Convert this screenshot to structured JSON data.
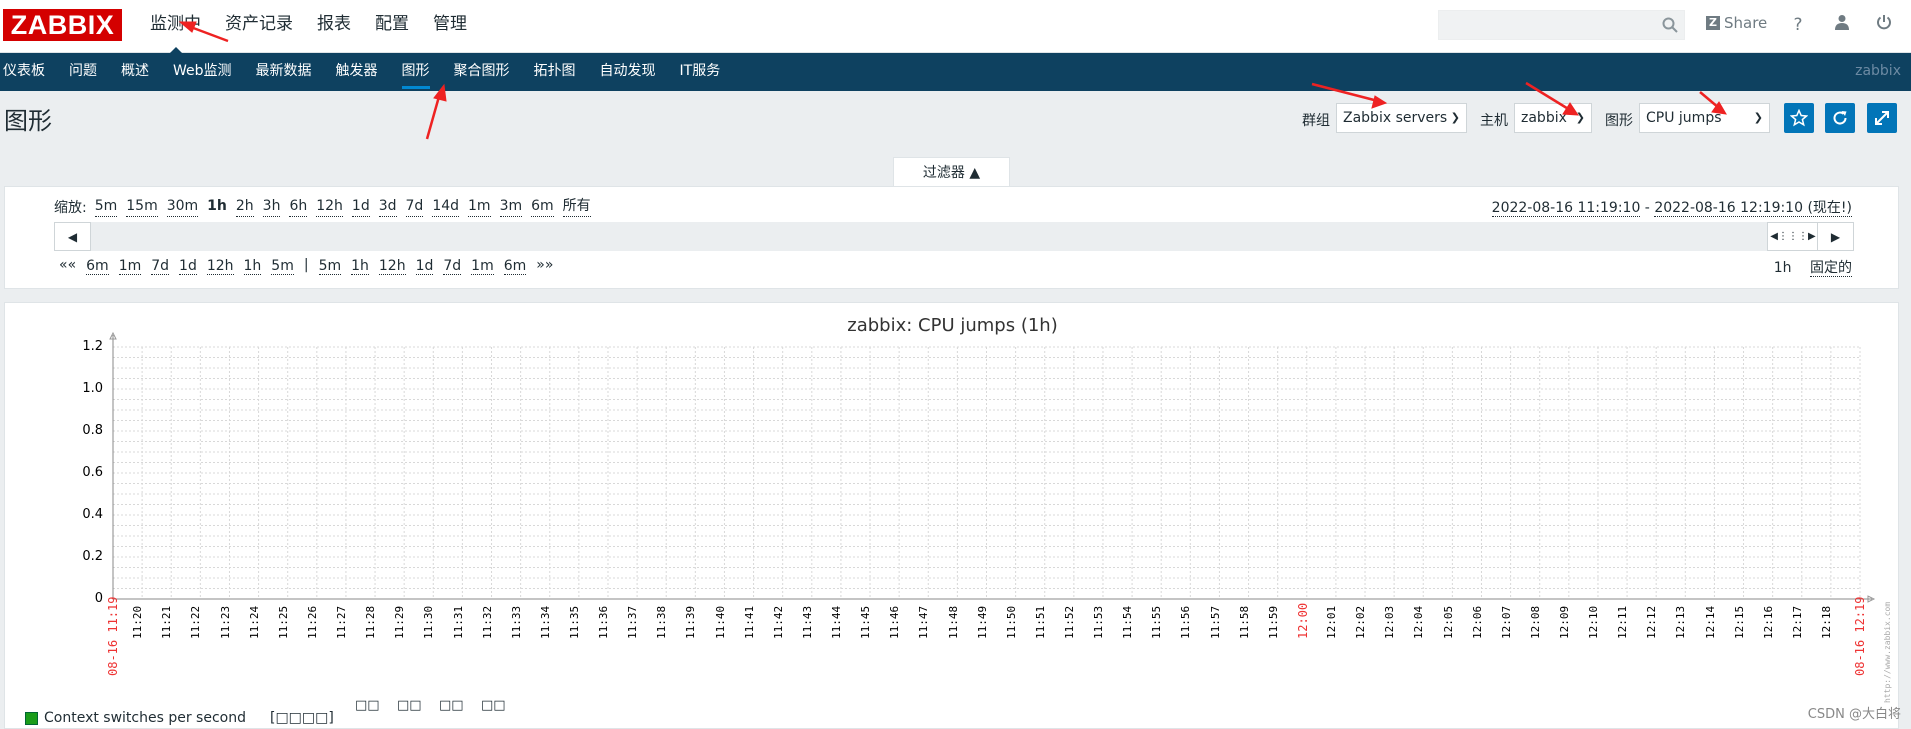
{
  "header": {
    "logo": "ZABBIX",
    "main_nav": [
      "监测中",
      "资产记录",
      "报表",
      "配置",
      "管理"
    ],
    "main_nav_active": 0,
    "search": {
      "value": "",
      "placeholder": ""
    },
    "share_label": "Share",
    "help_label": "?",
    "icons": [
      "search-icon",
      "share-icon",
      "help-icon",
      "user-icon",
      "power-icon"
    ]
  },
  "subnav": {
    "items": [
      "仪表板",
      "问题",
      "概述",
      "Web监测",
      "最新数据",
      "触发器",
      "图形",
      "聚合图形",
      "拓扑图",
      "自动发现",
      "IT服务"
    ],
    "active": 6,
    "user": "zabbix",
    "accent": "#0e4160"
  },
  "page": {
    "title": "图形",
    "group_label": "群组",
    "group_value": "Zabbix servers",
    "host_label": "主机",
    "host_value": "zabbix",
    "graph_label": "图形",
    "graph_value": "CPU jumps",
    "button_icons": [
      "star-icon",
      "refresh-icon",
      "fullscreen-icon"
    ]
  },
  "filter": {
    "tab_label": "过滤器 ▲",
    "zoom_label": "缩放:",
    "zoom_options": [
      "5m",
      "15m",
      "30m",
      "1h",
      "2h",
      "3h",
      "6h",
      "12h",
      "1d",
      "3d",
      "7d",
      "14d",
      "1m",
      "3m",
      "6m",
      "所有"
    ],
    "zoom_selected": "1h",
    "range_from": "2022-08-16 11:19:10",
    "range_sep": " - ",
    "range_to": "2022-08-16 12:19:10 (现在!)",
    "shift_back_label": "««",
    "shift_back": [
      "6m",
      "1m",
      "7d",
      "1d",
      "12h",
      "1h",
      "5m"
    ],
    "shift_sep": "|",
    "shift_forward": [
      "5m",
      "1h",
      "12h",
      "1d",
      "7d",
      "1m",
      "6m"
    ],
    "shift_forward_label": "»»",
    "period_value": "1h",
    "fixed_label": "固定的"
  },
  "graph": {
    "title": "zabbix: CPU jumps (1h)",
    "legend_item": "Context switches per second",
    "legend_extra": "[□□□□]",
    "legend_color": "#1a9c1a",
    "col_heads": [
      "□□",
      "□□",
      "□□",
      "□□"
    ],
    "url_text": "http://www.zabbix.com",
    "watermark": "CSDN @大白将"
  },
  "chart_data": {
    "type": "line",
    "title": "zabbix: CPU jumps (1h)",
    "y_ticks": [
      "0",
      "0.2",
      "0.4",
      "0.6",
      "0.8",
      "1.0",
      "1.2"
    ],
    "ylim": [
      0,
      1.2
    ],
    "x_ticks": [
      "11:20",
      "11:21",
      "11:22",
      "11:23",
      "11:24",
      "11:25",
      "11:26",
      "11:27",
      "11:28",
      "11:29",
      "11:30",
      "11:31",
      "11:32",
      "11:33",
      "11:34",
      "11:35",
      "11:36",
      "11:37",
      "11:38",
      "11:39",
      "11:40",
      "11:41",
      "11:42",
      "11:43",
      "11:44",
      "11:45",
      "11:46",
      "11:47",
      "11:48",
      "11:49",
      "11:50",
      "11:51",
      "11:52",
      "11:53",
      "11:54",
      "11:55",
      "11:56",
      "11:57",
      "11:58",
      "11:59",
      "12:00",
      "12:01",
      "12:02",
      "12:03",
      "12:04",
      "12:05",
      "12:06",
      "12:07",
      "12:08",
      "12:09",
      "12:10",
      "12:11",
      "12:12",
      "12:13",
      "12:14",
      "12:15",
      "12:16",
      "12:17",
      "12:18"
    ],
    "x_start": "08-16 11:19",
    "x_end": "08-16 12:19",
    "highlight_tick": "12:00",
    "series": [
      {
        "name": "Context switches per second",
        "values": []
      }
    ],
    "grid": true
  }
}
